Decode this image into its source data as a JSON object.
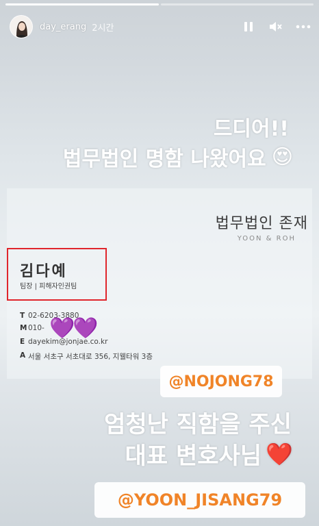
{
  "story": {
    "username": "day_erang",
    "time_ago": "2시간",
    "progress": [
      1.0,
      0.0
    ]
  },
  "controls": {
    "pause_icon": "pause-icon",
    "mute_icon": "mute-icon",
    "more_icon": "more-icon"
  },
  "caption_top": {
    "line1": "드디어!!",
    "line2": "법무법인 명함 나왔어요",
    "emoji": "😍"
  },
  "business_card": {
    "firm_name": "법무법인 존재",
    "firm_subtitle": "YOON & ROH",
    "person_name": "김다예",
    "person_title": "팀장 | 피해자인권팀",
    "contacts": [
      {
        "key": "T",
        "value": "02-6203-3880"
      },
      {
        "key": "M",
        "value": "010-"
      },
      {
        "key": "E",
        "value": "dayekim@jonjae.co.kr"
      },
      {
        "key": "A",
        "value": "서울 서초구 서초대로 356, 지웰타워 3층"
      }
    ],
    "redaction_stickers": [
      "💜",
      "💜"
    ]
  },
  "tags": {
    "tag1": "@NOJONG78",
    "tag2": "@YOON_JISANG79"
  },
  "caption_bottom": {
    "line1": "엄청난 직함을 주신",
    "line2": "대표 변호사님",
    "emoji": "❤️"
  },
  "colors": {
    "highlight_box": "#e0252b",
    "tag_text": "#f08428"
  }
}
